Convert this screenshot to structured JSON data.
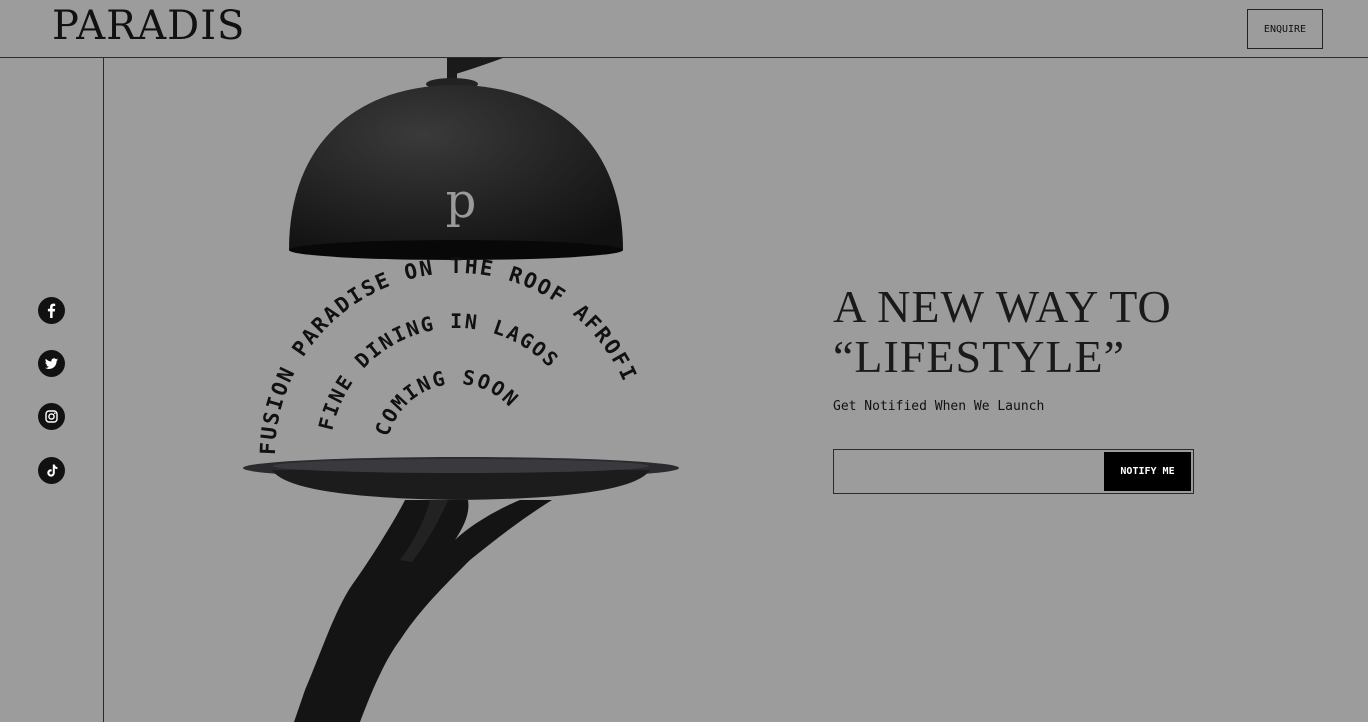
{
  "header": {
    "logo_text": "PARADIS",
    "enquire_label": "ENQUIRE"
  },
  "social": {
    "items": [
      "facebook-icon",
      "twitter-icon",
      "instagram-icon",
      "tiktok-icon"
    ]
  },
  "hero": {
    "cloche_letter": "p",
    "arc_outer": "FUSION PARADISE ON THE ROOF AFROFI",
    "arc_middle": "FINE DINING IN LAGOS",
    "arc_inner": "COMING SOON"
  },
  "main": {
    "headline_line1": "A NEW WAY TO",
    "headline_line2": "“LIFESTYLE”",
    "subtitle": "Get Notified When We Launch",
    "email_placeholder": "",
    "notify_label": "NOTIFY ME"
  },
  "colors": {
    "background": "#9c9c9c",
    "ink": "#111111",
    "button_bg": "#000000"
  }
}
